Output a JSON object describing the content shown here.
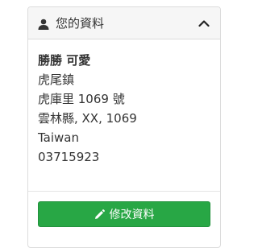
{
  "panel": {
    "title": "您的資料",
    "icon": "user-icon",
    "collapse_icon": "chevron-up-icon"
  },
  "address": {
    "name": "勝勝 可愛",
    "line1": "虎尾鎮",
    "line2": "虎庫里 1069 號",
    "line3": "雲林縣, XX, 1069",
    "country": "Taiwan",
    "phone": "03715923"
  },
  "actions": {
    "edit_label": "修改資料",
    "edit_icon": "pencil-icon",
    "edit_color": "#28a745"
  }
}
